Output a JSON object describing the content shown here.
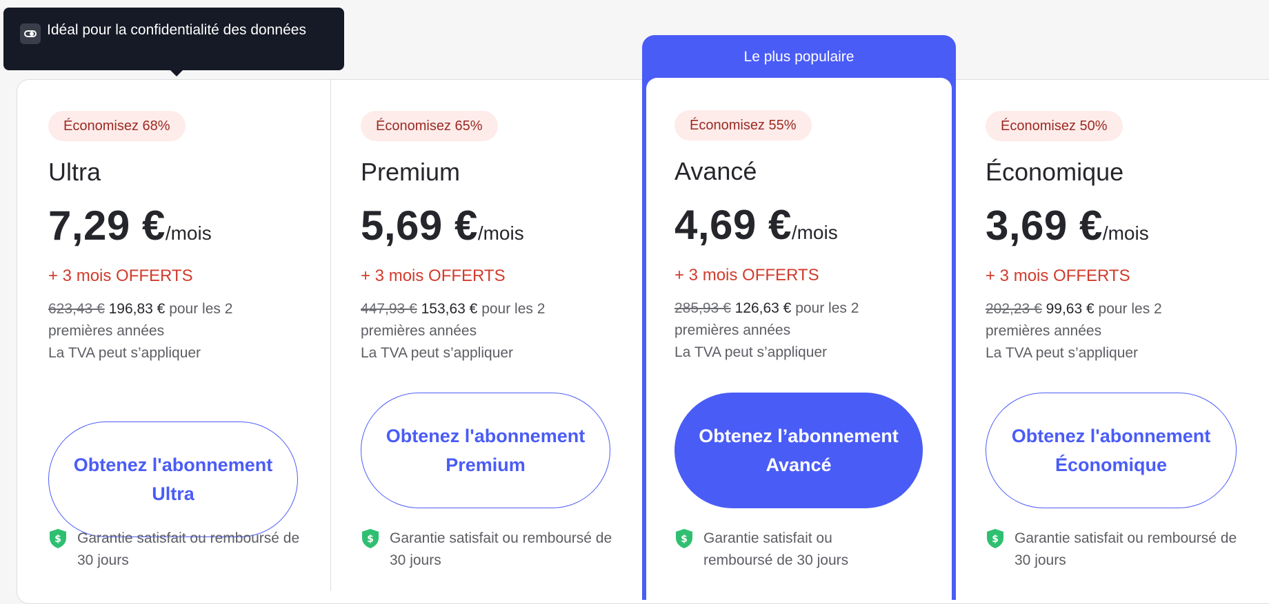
{
  "tooltip": {
    "icon": "toggle-icon",
    "text": "Idéal pour la confidentialité des données"
  },
  "popular_label": "Le plus populaire",
  "colors": {
    "accent": "#4a5cf6",
    "badge_bg": "#fdecea",
    "badge_text": "#9b2a22",
    "bonus": "#d13b2c",
    "shield": "#2fbf71"
  },
  "plans": [
    {
      "badge": "Économisez 68%",
      "name": "Ultra",
      "price": "7,29 €",
      "per": "/mois",
      "bonus": "+ 3 mois OFFERTS",
      "old_price": "623,43 €",
      "new_price": "196,83 €",
      "period": "pour les 2 premières années",
      "tax": "La TVA peut s’appliquer",
      "cta": "Obtenez l'abonnement Ultra",
      "guarantee": "Garantie satisfait ou remboursé de 30 jours"
    },
    {
      "badge": "Économisez 65%",
      "name": "Premium",
      "price": "5,69 €",
      "per": "/mois",
      "bonus": "+ 3 mois OFFERTS",
      "old_price": "447,93 €",
      "new_price": "153,63 €",
      "period": "pour les 2 premières années",
      "tax": "La TVA peut s’appliquer",
      "cta": "Obtenez l'abonnement Premium",
      "guarantee": "Garantie satisfait ou remboursé de 30 jours"
    },
    {
      "badge": "Économisez 55%",
      "name": "Avancé",
      "price": "4,69 €",
      "per": "/mois",
      "bonus": "+ 3 mois OFFERTS",
      "old_price": "285,93 €",
      "new_price": "126,63 €",
      "period": "pour les 2 premières années",
      "tax": "La TVA peut s’appliquer",
      "cta": "Obtenez l’abonnement Avancé",
      "guarantee": "Garantie satisfait ou remboursé de 30 jours"
    },
    {
      "badge": "Économisez 50%",
      "name": "Économique",
      "price": "3,69 €",
      "per": "/mois",
      "bonus": "+ 3 mois OFFERTS",
      "old_price": "202,23 €",
      "new_price": "99,63 €",
      "period": "pour les 2 premières années",
      "tax": "La TVA peut s’appliquer",
      "cta": "Obtenez l'abonnement Économique",
      "guarantee": "Garantie satisfait ou remboursé de 30 jours"
    }
  ]
}
